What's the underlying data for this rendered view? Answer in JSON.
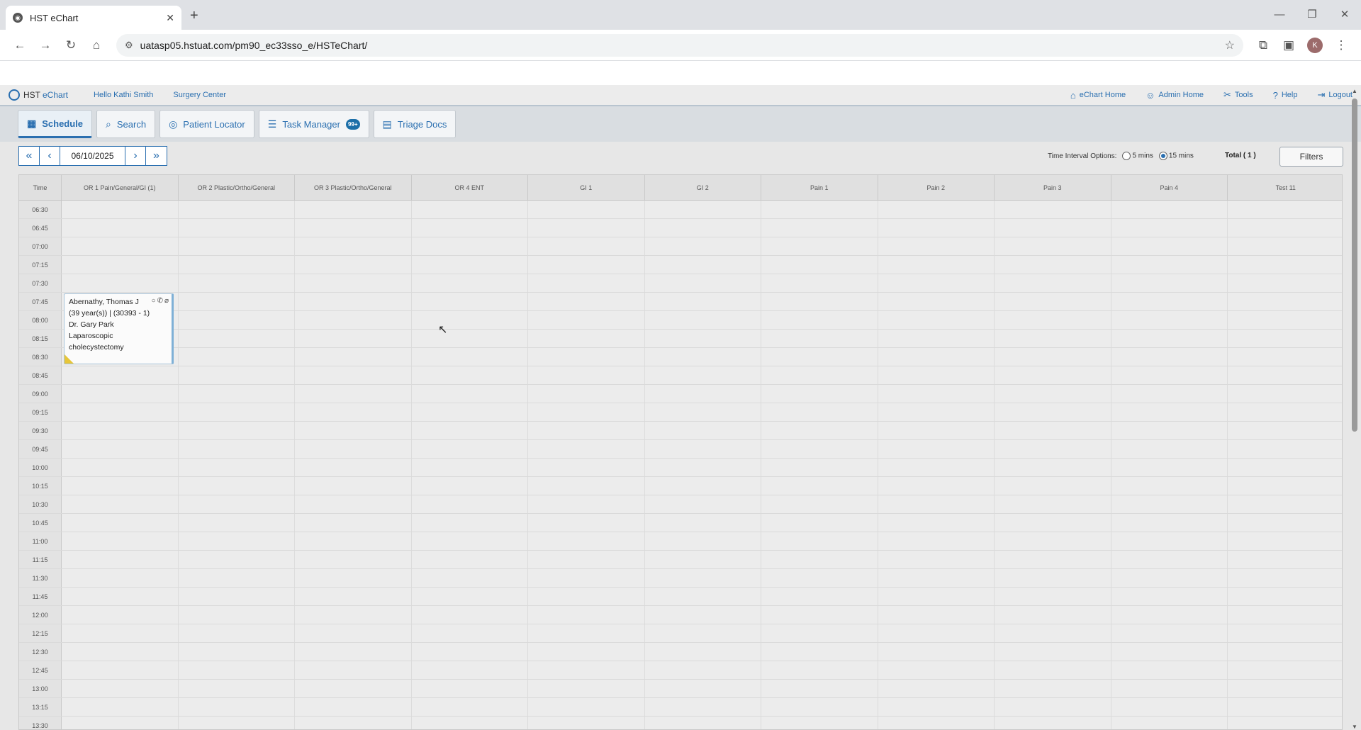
{
  "browser": {
    "tab_title": "HST eChart",
    "url": "uatasp05.hstuat.com/pm90_ec33sso_e/HSTeChart/",
    "avatar_letter": "K"
  },
  "header": {
    "logo_hst": "HST",
    "logo_echart": "eChart",
    "greeting": "Hello Kathi Smith",
    "facility": "Surgery Center",
    "links": [
      "eChart Home",
      "Admin Home",
      "Tools",
      "Help",
      "Logout"
    ]
  },
  "tabs": {
    "schedule": "Schedule",
    "search": "Search",
    "patient_locator": "Patient Locator",
    "task_manager": "Task Manager",
    "task_badge": "99+",
    "triage_docs": "Triage Docs"
  },
  "toolbar": {
    "date": "06/10/2025",
    "interval_label": "Time Interval Options:",
    "opt_5": "5 mins",
    "opt_15": "15 mins",
    "total": "Total ( 1 )",
    "filters": "Filters"
  },
  "grid": {
    "time_header": "Time",
    "rooms": [
      "OR 1 Pain/General/GI   (1)",
      "OR 2 Plastic/Ortho/General",
      "OR 3 Plastic/Ortho/General",
      "OR 4 ENT",
      "GI 1",
      "GI 2",
      "Pain 1",
      "Pain 2",
      "Pain 3",
      "Pain 4",
      "Test 11"
    ],
    "times": [
      "06:30",
      "06:45",
      "07:00",
      "07:15",
      "07:30",
      "07:45",
      "08:00",
      "08:15",
      "08:30",
      "08:45",
      "09:00",
      "09:15",
      "09:30",
      "09:45",
      "10:00",
      "10:15",
      "10:30",
      "10:45",
      "11:00",
      "11:15",
      "11:30",
      "11:45",
      "12:00",
      "12:15",
      "12:30",
      "12:45",
      "13:00",
      "13:15",
      "13:30"
    ]
  },
  "appointment": {
    "patient": "Abernathy, Thomas J",
    "details": "(39 year(s)) | (30393 - 1)",
    "doctor": "Dr. Gary Park",
    "procedure_1": "Laparoscopic",
    "procedure_2": "cholecystectomy"
  }
}
